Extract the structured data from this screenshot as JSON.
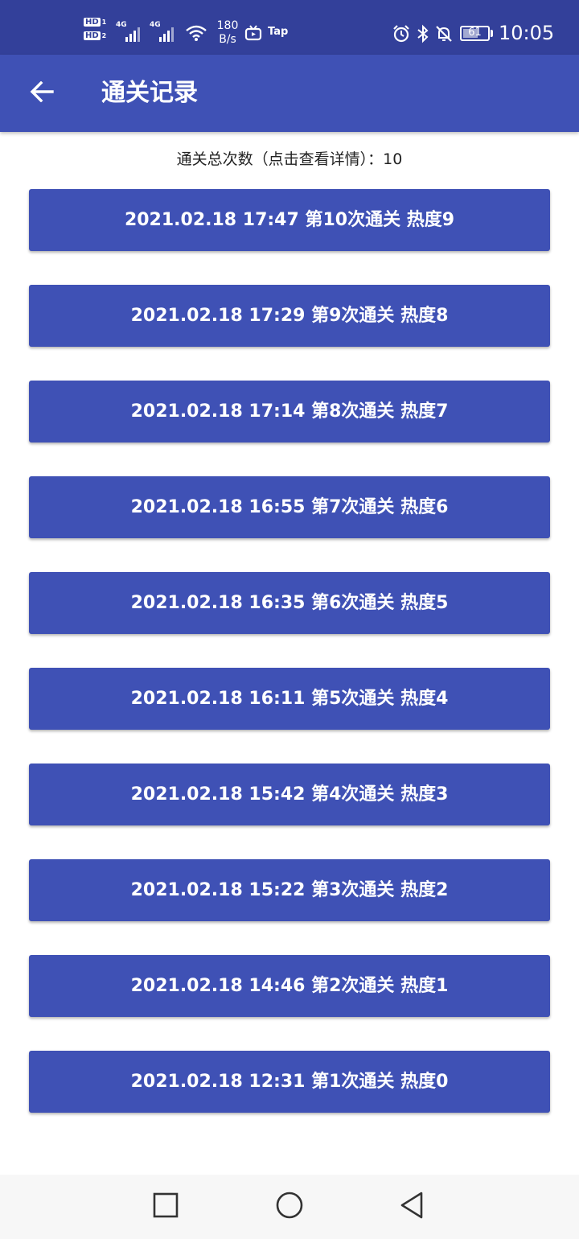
{
  "status_bar": {
    "sim1": "HD",
    "sim1_index": "1",
    "sim2": "HD",
    "sim2_index": "2",
    "network1": "4G",
    "network2": "4G",
    "speed_value": "180",
    "speed_unit": "B/s",
    "tap_label": "Tap",
    "battery_level": "61",
    "time": "10:05"
  },
  "icons": {
    "back": "arrow-left-icon",
    "alarm": "alarm-icon",
    "bluetooth": "bluetooth-icon",
    "mute": "bell-off-icon",
    "wifi": "wifi-icon",
    "tap": "tv-icon"
  },
  "app_bar": {
    "title": "通关记录"
  },
  "summary": {
    "text": "通关总次数（点击查看详情）：10"
  },
  "records": [
    {
      "label": "2021.02.18 17:47 第10次通关 热度9"
    },
    {
      "label": "2021.02.18 17:29 第9次通关 热度8"
    },
    {
      "label": "2021.02.18 17:14 第8次通关 热度7"
    },
    {
      "label": "2021.02.18 16:55 第7次通关 热度6"
    },
    {
      "label": "2021.02.18 16:35 第6次通关 热度5"
    },
    {
      "label": "2021.02.18 16:11 第5次通关 热度4"
    },
    {
      "label": "2021.02.18 15:42 第4次通关 热度3"
    },
    {
      "label": "2021.02.18 15:22 第3次通关 热度2"
    },
    {
      "label": "2021.02.18 14:46 第2次通关 热度1"
    },
    {
      "label": "2021.02.18 12:31 第1次通关 热度0"
    }
  ],
  "colors": {
    "status_bar": "#33409a",
    "primary": "#3f51b5",
    "nav_bar": "#f7f7f7"
  }
}
